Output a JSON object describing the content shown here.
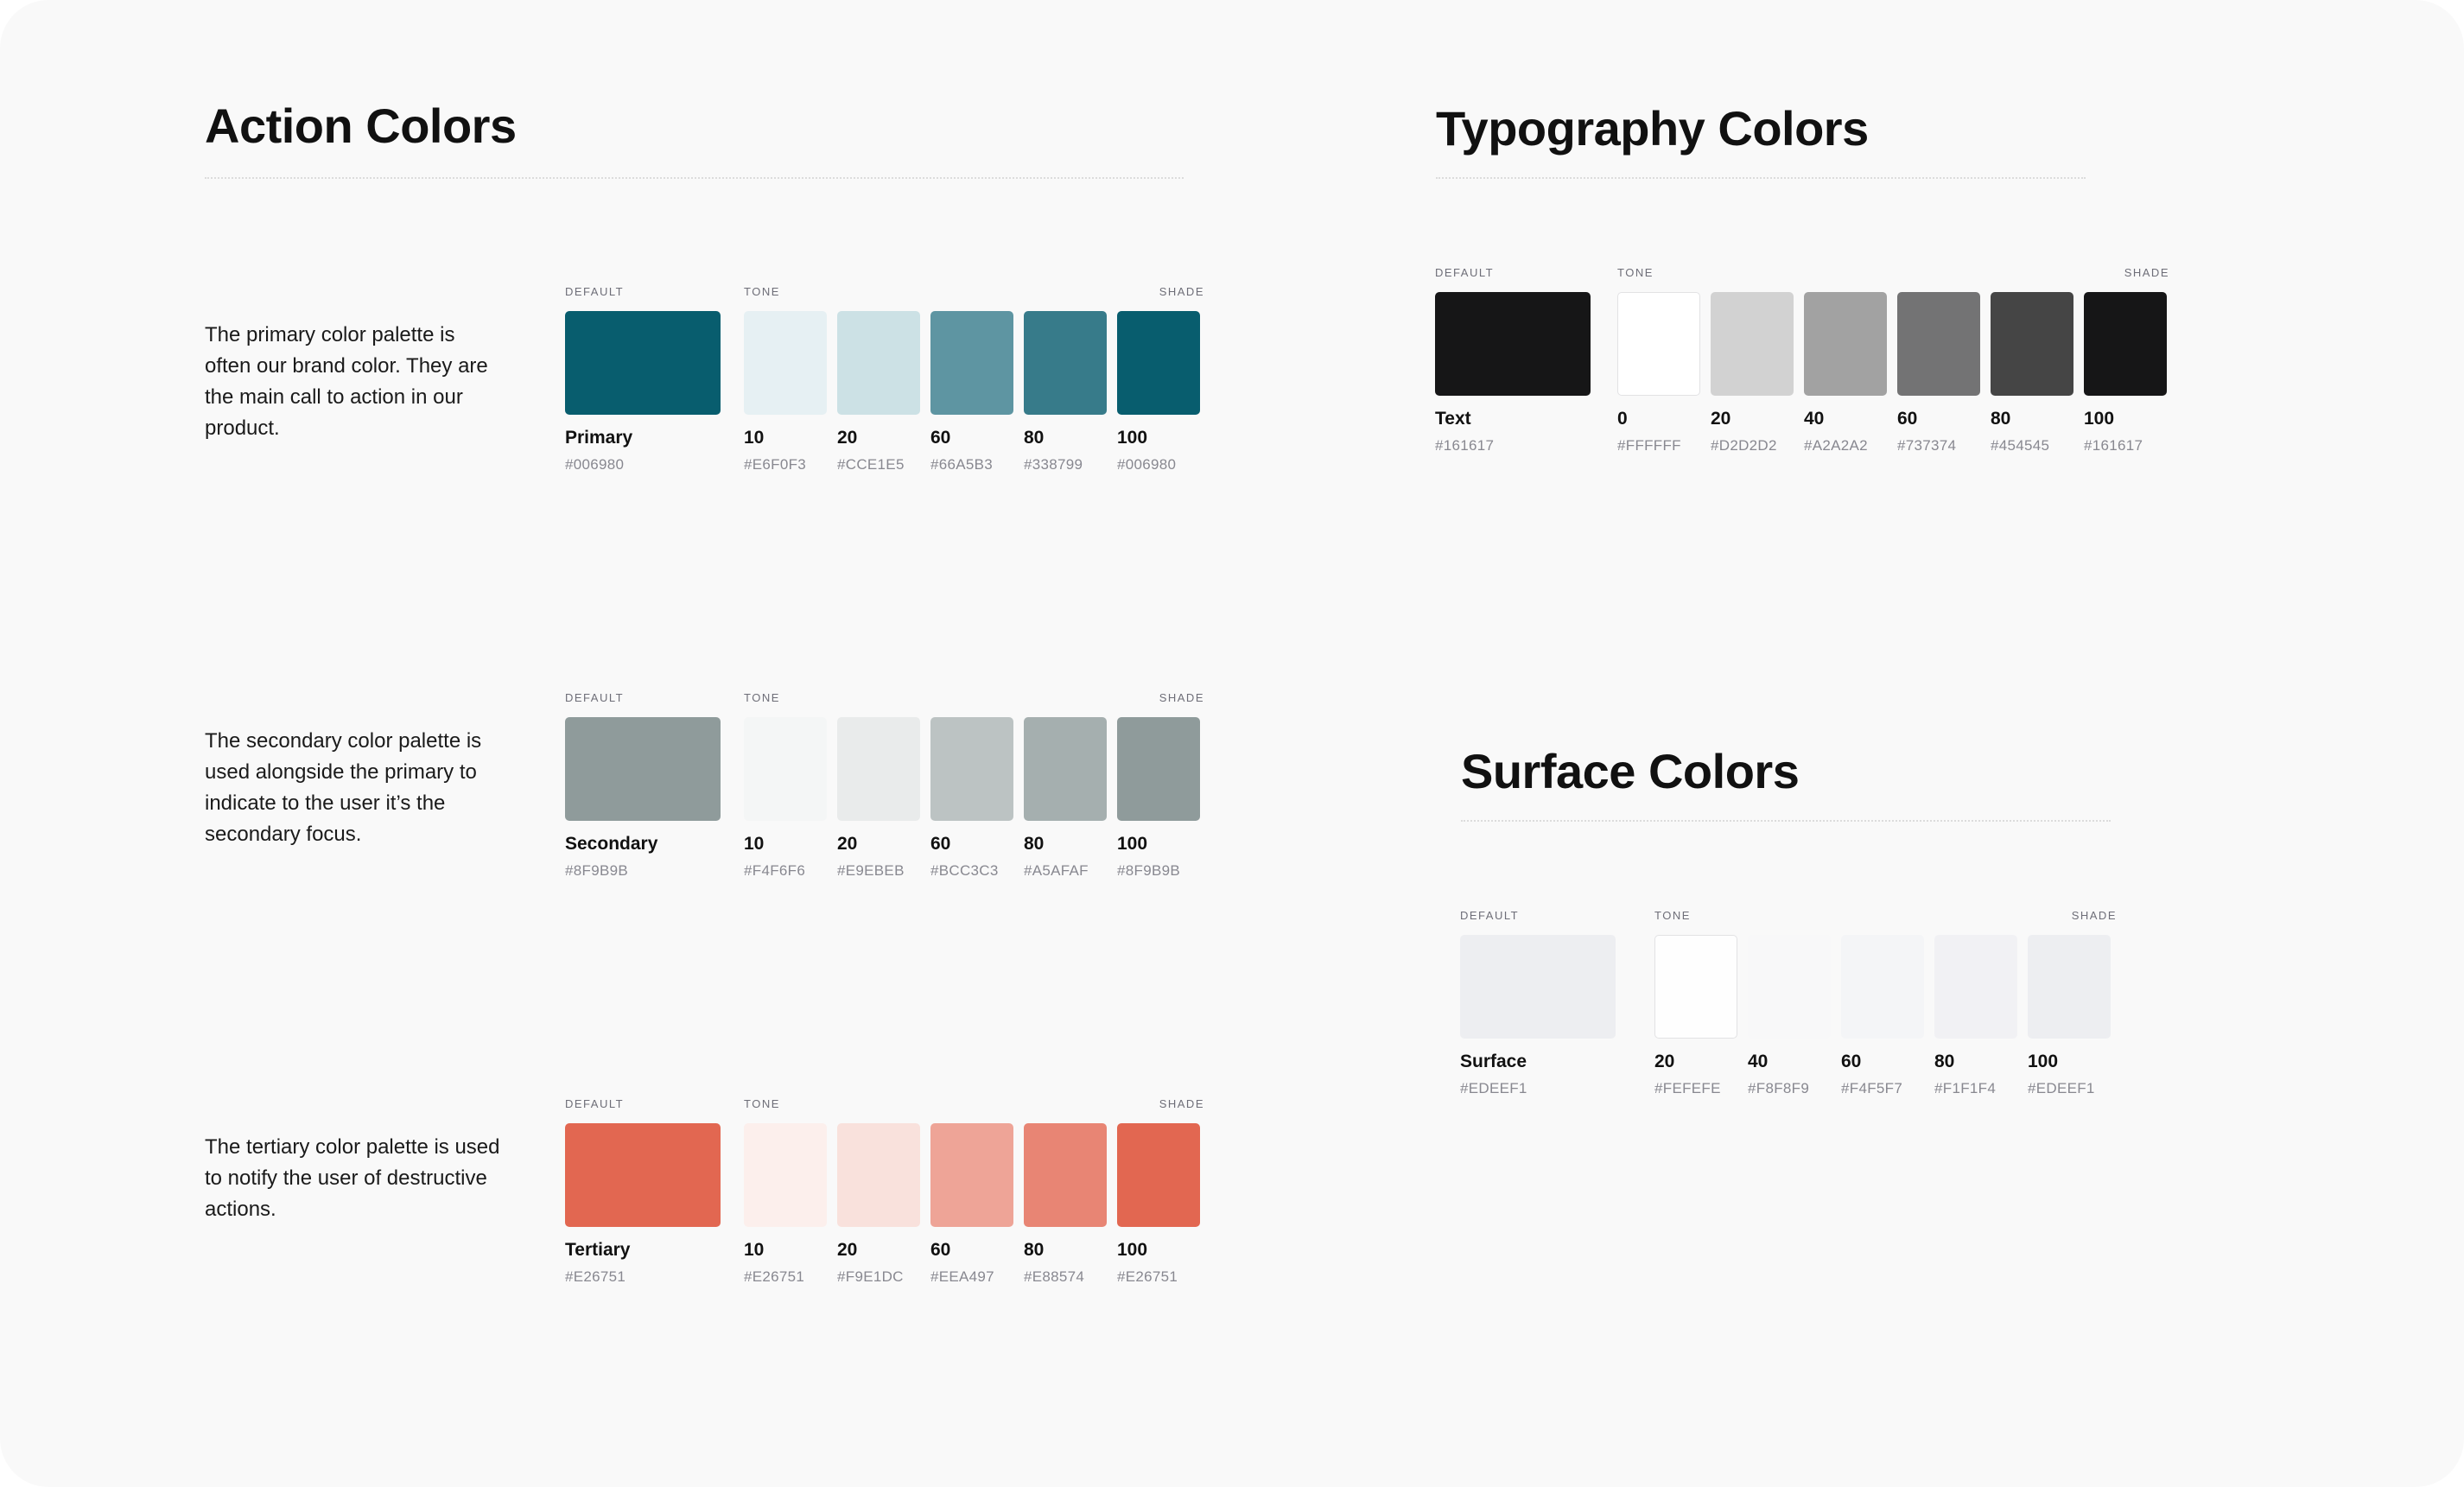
{
  "action": {
    "title": "Action Colors",
    "palettes": [
      {
        "description": "The primary color palette is often our brand color. They are the main call to action in our product.",
        "labels": {
          "default": "DEFAULT",
          "tone": "TONE",
          "shade": "SHADE"
        },
        "swatches": [
          {
            "name": "Primary",
            "hex": "#006980",
            "color": "#085D6E"
          },
          {
            "name": "10",
            "hex": "#E6F0F3",
            "color": "#E6F0F3"
          },
          {
            "name": "20",
            "hex": "#CCE1E5",
            "color": "#CCE1E5"
          },
          {
            "name": "60",
            "hex": "#66A5B3",
            "color": "#5E95A2"
          },
          {
            "name": "80",
            "hex": "#338799",
            "color": "#377B8A"
          },
          {
            "name": "100",
            "hex": "#006980",
            "color": "#085D6E"
          }
        ]
      },
      {
        "description": "The secondary color palette is used alongside the primary to indicate to the user it’s the secondary focus.",
        "labels": {
          "default": "DEFAULT",
          "tone": "TONE",
          "shade": "SHADE"
        },
        "swatches": [
          {
            "name": "Secondary",
            "hex": "#8F9B9B",
            "color": "#8F9B9B"
          },
          {
            "name": "10",
            "hex": "#F4F6F6",
            "color": "#F4F6F6"
          },
          {
            "name": "20",
            "hex": "#E9EBEB",
            "color": "#E9EBEB"
          },
          {
            "name": "60",
            "hex": "#BCC3C3",
            "color": "#BCC3C3"
          },
          {
            "name": "80",
            "hex": "#A5AFAF",
            "color": "#A5AFAF"
          },
          {
            "name": "100",
            "hex": "#8F9B9B",
            "color": "#8F9B9B"
          }
        ]
      },
      {
        "description": "The tertiary color palette is used to notify the user of destructive actions.",
        "labels": {
          "default": "DEFAULT",
          "tone": "TONE",
          "shade": "SHADE"
        },
        "swatches": [
          {
            "name": "Tertiary",
            "hex": "#E26751",
            "color": "#E26751"
          },
          {
            "name": "10",
            "hex": "#E26751",
            "color": "#FCEFEC"
          },
          {
            "name": "20",
            "hex": "#F9E1DC",
            "color": "#F9E1DC"
          },
          {
            "name": "60",
            "hex": "#EEA497",
            "color": "#EEA497"
          },
          {
            "name": "80",
            "hex": "#E88574",
            "color": "#E88574"
          },
          {
            "name": "100",
            "hex": "#E26751",
            "color": "#E26751"
          }
        ]
      }
    ]
  },
  "typography": {
    "title": "Typography Colors",
    "palette": {
      "labels": {
        "default": "DEFAULT",
        "tone": "TONE",
        "shade": "SHADE"
      },
      "swatches": [
        {
          "name": "Text",
          "hex": "#161617",
          "color": "#161617"
        },
        {
          "name": "0",
          "hex": "#FFFFFF",
          "color": "#FFFFFF"
        },
        {
          "name": "20",
          "hex": "#D2D2D2",
          "color": "#D2D2D2"
        },
        {
          "name": "40",
          "hex": "#A2A2A2",
          "color": "#A2A2A2"
        },
        {
          "name": "60",
          "hex": "#737374",
          "color": "#737374"
        },
        {
          "name": "80",
          "hex": "#454545",
          "color": "#454545"
        },
        {
          "name": "100",
          "hex": "#161617",
          "color": "#161617"
        }
      ]
    }
  },
  "surface": {
    "title": "Surface Colors",
    "palette": {
      "labels": {
        "default": "DEFAULT",
        "tone": "TONE",
        "shade": "SHADE"
      },
      "swatches": [
        {
          "name": "Surface",
          "hex": "#EDEEF1",
          "color": "#EDEEF1"
        },
        {
          "name": "20",
          "hex": "#FEFEFE",
          "color": "#FEFEFE"
        },
        {
          "name": "40",
          "hex": "#F8F8F9",
          "color": "#F8F8F9"
        },
        {
          "name": "60",
          "hex": "#F4F5F7",
          "color": "#F4F5F7"
        },
        {
          "name": "80",
          "hex": "#F1F1F4",
          "color": "#F1F1F4"
        },
        {
          "name": "100",
          "hex": "#EDEEF1",
          "color": "#EDEEF1"
        }
      ]
    }
  }
}
